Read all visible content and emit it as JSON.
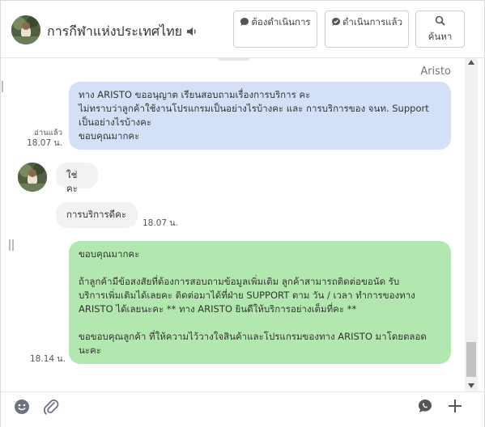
{
  "header": {
    "title": "การกีฬาแห่งประเทศไทย",
    "buttons": [
      {
        "label": "ต้องดำเนินการ",
        "icon": "speech-bubble-icon"
      },
      {
        "label": "ดำเนินการแล้ว",
        "icon": "chat-check-icon"
      },
      {
        "label": "ค้นหา",
        "icon": "search-icon"
      }
    ]
  },
  "chat": {
    "sender_name": "Aristo",
    "messages": [
      {
        "side": "out",
        "lines": [
          "ทาง ARISTO ขออนุญาต เรียนสอบถามเรื่องการบริการ คะ",
          "ไม่ทราบว่าลูกค้าใช้งานโปรแกรมเป็นอย่างไรบ้างคะ และ การบริการของ จนท. Support",
          "เป็นอย่างไรบ้างคะ",
          "ขอบคุณมากคะ"
        ],
        "read_label": "อ่านแล้ว",
        "time": "18.07 น."
      },
      {
        "side": "in",
        "text": "ใช่คะ"
      },
      {
        "side": "in",
        "text": "การบริการดีคะ",
        "time": "18.07 น."
      },
      {
        "side": "out",
        "lines": [
          "ขอบคุณมากคะ",
          "",
          "ถ้าลูกค้ามีข้อสงสัยที่ต้องการสอบถามข้อมูลเพิ่มเติม ลูกค้าสามารถติดต่อขอนัด รับ",
          "บริการเพิ่มเติมได้เลยคะ ติดต่อมาได้ที่ฝ่าย SUPPORT ตาม วัน / เวลา ทำการของทาง",
          "ARISTO ได้เลยนะคะ ** ทาง ARISTO ยินดีให้บริการอย่างเต็มที่คะ **",
          "",
          "ขอขอบคุณลูกค้า ที่ให้ความไว้วางใจสินค้าและโปรแกรมของทาง ARISTO มาโดยตลอด",
          "นะคะ"
        ],
        "time": "18.14 น."
      }
    ]
  },
  "footer": {
    "icons": [
      "emoji-icon",
      "paperclip-icon",
      "chat-bubble-icon",
      "plus-icon"
    ]
  },
  "colors": {
    "outgoing_blue": "#d3e0f7",
    "outgoing_green": "#b3e7b0",
    "incoming_gray": "#f2f2f2"
  }
}
